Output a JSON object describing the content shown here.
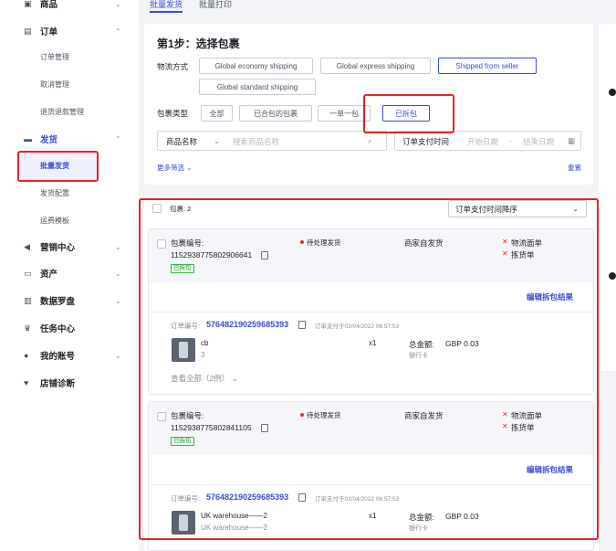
{
  "sidebar": {
    "groups": [
      {
        "label": "商品",
        "icon": "product-icon"
      },
      {
        "label": "订单",
        "icon": "order-icon",
        "subs": [
          "订单管理",
          "取消管理",
          "退货退款管理"
        ]
      },
      {
        "label": "发货",
        "icon": "shipping-icon",
        "subs": [
          "批量发货",
          "发货配置",
          "运费模板"
        ]
      },
      {
        "label": "营销中心",
        "icon": "megaphone-icon"
      },
      {
        "label": "资产",
        "icon": "wallet-icon"
      },
      {
        "label": "数据罗盘",
        "icon": "bar-chart-icon"
      },
      {
        "label": "任务中心",
        "icon": "trophy-icon"
      },
      {
        "label": "我的账号",
        "icon": "user-icon"
      },
      {
        "label": "店铺诊断",
        "icon": "shop-health-icon"
      }
    ]
  },
  "tabs": [
    "批量发货",
    "批量打印"
  ],
  "step": {
    "title": "第1步：选择包裹",
    "logistics_label": "物流方式",
    "logistics_options": [
      "Global economy shipping",
      "Global express shipping",
      "Shipped from seller",
      "Global standard shipping"
    ],
    "package_type_label": "包裹类型",
    "package_types": [
      "全部",
      "已合包的包裹",
      "一单一包",
      "已拆包"
    ],
    "product_select": "商品名称",
    "search_placeholder": "搜索商品名称",
    "date_label": "订单支付时间",
    "start_placeholder": "开始日期",
    "date_sep": "-",
    "end_placeholder": "结束日期",
    "more_filters": "更多筛选",
    "reset": "重置"
  },
  "list": {
    "count_label": "包裹: 2",
    "sort_label": "订单支付时间降序",
    "packages": [
      {
        "pkg_label": "包裹编号:",
        "pkg_no": "1152938775802906641",
        "badge": "已拆包",
        "status": "待处理发货",
        "ship_mode": "商家自发货",
        "checks": [
          "物流面单",
          "拣货单"
        ],
        "edit": "编辑拆包结果",
        "order_prefix": "订单编号:",
        "order_no": "576482190259685393",
        "paid_time": "订单支付于02/04/2022 06:57:53",
        "item_name": "cb",
        "item_sub": "3",
        "qty": "x1",
        "total_label": "总金额:",
        "total": "GBP 0.03",
        "pay_method": "银行卡",
        "view_all": "查看全部（2例）"
      },
      {
        "pkg_label": "包裹编号:",
        "pkg_no": "1152938775802841105",
        "badge": "已拆包",
        "status": "待处理发货",
        "ship_mode": "商家自发货",
        "checks": [
          "物流面单",
          "拣货单"
        ],
        "edit": "编辑拆包结果",
        "order_prefix": "订单编号:",
        "order_no": "576482190259685393",
        "paid_time": "订单支付于02/04/2022 06:57:53",
        "item_name": "UK warehouse——2",
        "item_sub": "UK warehouse——2",
        "qty": "x1",
        "total_label": "总金额:",
        "total": "GBP 0.03",
        "pay_method": "银行卡"
      }
    ]
  },
  "colors": {
    "accent": "#3a4bdb",
    "annotation": "#e4232b",
    "success": "#39b549"
  }
}
